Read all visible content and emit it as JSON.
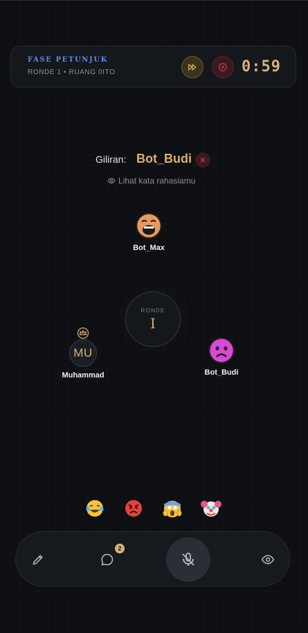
{
  "header": {
    "phase": "FASE PETUNJUK",
    "round_info": "RONDE 1 • RUANG 0ITO",
    "timer": "0:59",
    "skip_icon": "fast-forward-icon",
    "close_icon": "close-circle-icon"
  },
  "turn": {
    "label": "Giliran:",
    "player": "Bot_Budi",
    "secret_link": "Lihat kata rahasiamu"
  },
  "center": {
    "round_label": "RONDE",
    "round_number": "I"
  },
  "players": [
    {
      "name": "Bot_Max",
      "avatar": "yawning-face-icon"
    },
    {
      "name": "Muhammad",
      "initials": "MU",
      "host": true,
      "avatar": "crown-icon"
    },
    {
      "name": "Bot_Budi",
      "avatar": "frowning-face-icon"
    }
  ],
  "reactions": [
    "laughing-face-icon",
    "angry-face-icon",
    "screaming-face-icon",
    "clown-face-icon"
  ],
  "bottom_bar": {
    "chat_badge": "2",
    "mic_state": "muted"
  },
  "colors": {
    "accent_gold": "#d9b277",
    "phase_blue": "#5f8fe0",
    "background": "#0d0f13",
    "danger": "#c0414f"
  }
}
